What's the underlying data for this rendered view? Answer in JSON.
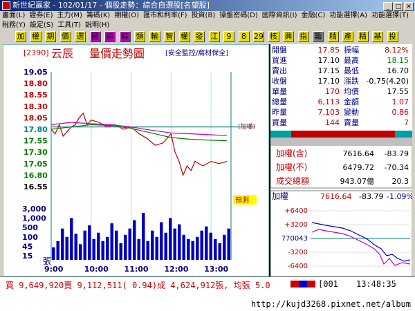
{
  "window": {
    "title": "新世紀贏家 - 102/01/17 - 個股走勢：綜合自選股[名望股]"
  },
  "menu": {
    "row1": [
      "畫面(L)",
      "證券(E)",
      "主力(M)",
      "籌碼(K)",
      "期權(O)",
      "匯市和利率(F)",
      "投資(B)",
      "操盤密碼(D)",
      "國際資訊(I)",
      "金融(C)",
      "功能選擇(A)",
      "功能選擇(T)"
    ],
    "row2": [
      "稅務(Y)",
      "設定(S)",
      "工具(T)",
      "說明(H)"
    ]
  },
  "toolbar": {
    "buttons": [
      {
        "label": "加",
        "bg": "#e8e000"
      },
      {
        "label": "權",
        "bg": "#e8e000"
      },
      {
        "label": "期",
        "bg": "#e8e000"
      },
      {
        "label": "價",
        "bg": "#e8e000"
      },
      {
        "label": "選",
        "bg": "#e8e000"
      },
      {
        "label": "國",
        "bg": "#c000c0"
      },
      {
        "label": "綜",
        "bg": "#c000c0"
      },
      {
        "label": "綜",
        "bg": "#c000c0"
      },
      {
        "label": "類",
        "bg": "#e8e000"
      },
      {
        "label": "輸",
        "bg": "#e8e000"
      },
      {
        "label": "智",
        "bg": "#e8e000"
      },
      {
        "label": "權",
        "bg": "#e8e000"
      },
      {
        "label": "發",
        "bg": "#e8e000"
      },
      {
        "label": "江",
        "bg": "#e8e000"
      },
      {
        "label": "9",
        "bg": "#e8e000"
      },
      {
        "label": "8",
        "bg": "#e8e000"
      },
      {
        "label": "29",
        "bg": "#e8e000"
      },
      {
        "label": "核",
        "bg": "#e8e000"
      },
      {
        "label": "興",
        "bg": "#e8e000"
      },
      {
        "label": "指",
        "bg": "#e8e000"
      },
      {
        "label": "籌",
        "bg": "#808080"
      },
      {
        "label": "精",
        "bg": "#e8e000"
      },
      {
        "label": "產",
        "bg": "#e8e000"
      },
      {
        "label": "精",
        "bg": "#e8e000"
      },
      {
        "label": "基",
        "bg": "#e8e000"
      },
      {
        "label": "投",
        "bg": "#e8e000"
      }
    ]
  },
  "stock": {
    "code": "[2390]",
    "name": "云辰",
    "chart_title": "量價走勢圖",
    "tag": "[安全監控/窩材保全]",
    "right_label": "(加權)"
  },
  "quote": [
    {
      "l1": "開盤",
      "v1": "17.85",
      "c1": "#c00000",
      "l2": "振幅",
      "v2": "8.12%",
      "c2": "#c00000"
    },
    {
      "l1": "買進",
      "v1": "17.10",
      "c1": "#000000",
      "l2": "最高",
      "v2": "18.15",
      "c2": "#008000"
    },
    {
      "l1": "賣出",
      "v1": "17.15",
      "c1": "#000000",
      "l2": "最低",
      "v2": "16.70",
      "c2": "#000000"
    },
    {
      "l1": "收盤",
      "v1": "17.10",
      "c1": "#000000",
      "l2": "漲跌",
      "v2": "-0.75(4.20)",
      "c2": "#000000"
    },
    {
      "l1": "單量",
      "v1": "170",
      "c1": "#c00000",
      "l2": "均價",
      "v2": "17.55",
      "c2": "#000000"
    },
    {
      "l1": "總量",
      "v1": "6,113",
      "c1": "#c00000",
      "l2": "金額",
      "v2": "1.07",
      "c2": "#c00000"
    },
    {
      "l1": "昨量",
      "v1": "7,103",
      "c1": "#c00000",
      "l2": "變動",
      "v2": "0.86",
      "c2": "#c00000"
    },
    {
      "l1": "買量",
      "v1": "144",
      "c1": "#c00000",
      "l2": "賣量",
      "v2": "7",
      "c2": "#c00000"
    }
  ],
  "index_summary": [
    {
      "label": "加權(含)",
      "value": "7616.64",
      "change": "-83.79"
    },
    {
      "label": "加權(不)",
      "value": "6479.72",
      "change": "-70.34"
    },
    {
      "label": "成交總額",
      "value": "943.07億",
      "change": "20.3"
    }
  ],
  "mini": {
    "label": "加權",
    "value": "7616.64",
    "change": "-83.79",
    "pct": "-1.09%",
    "ticks": [
      "+6400",
      "+3200",
      "770043",
      "-3200",
      "-6400"
    ]
  },
  "status": {
    "text": "買 9,649,920賣 9,112,511( 0.94)成 4,624,912張, 均張 5.0",
    "code": "[001",
    "time": "13:48:35"
  },
  "footer": {
    "url": "http://kujd3268.pixnet.net/album"
  },
  "pre_open_badge": "預測",
  "chart_data": {
    "type": "line",
    "title": "量價走勢圖",
    "x": [
      "9:00",
      "10:00",
      "11:00",
      "12:00",
      "13:00"
    ],
    "price_ticks": [
      "19.05",
      "18.80",
      "18.55",
      "18.30",
      "18.05",
      "17.80",
      "17.55",
      "17.30",
      "17.05",
      "16.80",
      "16.55"
    ],
    "price_tick_colors": [
      "#000080",
      "#c00000",
      "#c00000",
      "#c00000",
      "#c00000",
      "#008080",
      "#008000",
      "#008000",
      "#008000",
      "#008000",
      "#000000"
    ],
    "price_ylim": [
      16.55,
      19.05
    ],
    "ref_price": 17.85,
    "volume_ticks": [
      "3,000",
      "1,000",
      "500",
      "100",
      "45",
      "15"
    ],
    "volume_unit": "張",
    "series": [
      {
        "name": "price",
        "color": "#c00000",
        "values": [
          [
            9.0,
            17.8
          ],
          [
            9.1,
            17.7
          ],
          [
            9.2,
            17.9
          ],
          [
            9.3,
            17.65
          ],
          [
            9.4,
            17.75
          ],
          [
            9.5,
            17.85
          ],
          [
            9.6,
            17.9
          ],
          [
            9.7,
            18.05
          ],
          [
            9.8,
            18.15
          ],
          [
            9.9,
            17.9
          ],
          [
            10.0,
            18.0
          ],
          [
            10.2,
            17.95
          ],
          [
            10.4,
            17.85
          ],
          [
            10.6,
            17.9
          ],
          [
            10.8,
            17.8
          ],
          [
            11.0,
            17.85
          ],
          [
            11.2,
            17.7
          ],
          [
            11.4,
            17.6
          ],
          [
            11.6,
            17.45
          ],
          [
            11.8,
            17.5
          ],
          [
            12.0,
            17.7
          ],
          [
            12.1,
            17.3
          ],
          [
            12.2,
            17.1
          ],
          [
            12.3,
            16.8
          ],
          [
            12.4,
            17.0
          ],
          [
            12.5,
            16.9
          ],
          [
            12.6,
            17.1
          ],
          [
            12.8,
            17.0
          ],
          [
            13.0,
            17.1
          ],
          [
            13.2,
            17.05
          ],
          [
            13.4,
            17.1
          ]
        ]
      },
      {
        "name": "avg",
        "color": "#008000",
        "values": [
          [
            9.0,
            17.8
          ],
          [
            9.5,
            17.85
          ],
          [
            10.0,
            17.9
          ],
          [
            10.5,
            17.88
          ],
          [
            11.0,
            17.82
          ],
          [
            11.5,
            17.72
          ],
          [
            12.0,
            17.62
          ],
          [
            12.5,
            17.58
          ],
          [
            13.0,
            17.56
          ],
          [
            13.4,
            17.55
          ]
        ]
      },
      {
        "name": "index",
        "color": "#c000c0",
        "values": [
          [
            9.0,
            17.9
          ],
          [
            9.5,
            17.95
          ],
          [
            10.0,
            17.92
          ],
          [
            10.5,
            17.9
          ],
          [
            11.0,
            17.85
          ],
          [
            11.5,
            17.78
          ],
          [
            12.0,
            17.72
          ],
          [
            12.5,
            17.7
          ],
          [
            13.0,
            17.68
          ],
          [
            13.4,
            17.66
          ]
        ]
      }
    ],
    "volume": [
      12,
      18,
      30,
      22,
      40,
      25,
      15,
      28,
      33,
      20,
      26,
      18,
      22,
      35,
      28,
      16,
      24,
      30,
      38,
      20,
      45,
      18,
      28,
      22,
      36,
      26,
      40,
      30,
      34,
      24,
      20,
      18,
      22,
      28,
      32,
      26,
      20,
      16,
      24,
      30
    ]
  }
}
